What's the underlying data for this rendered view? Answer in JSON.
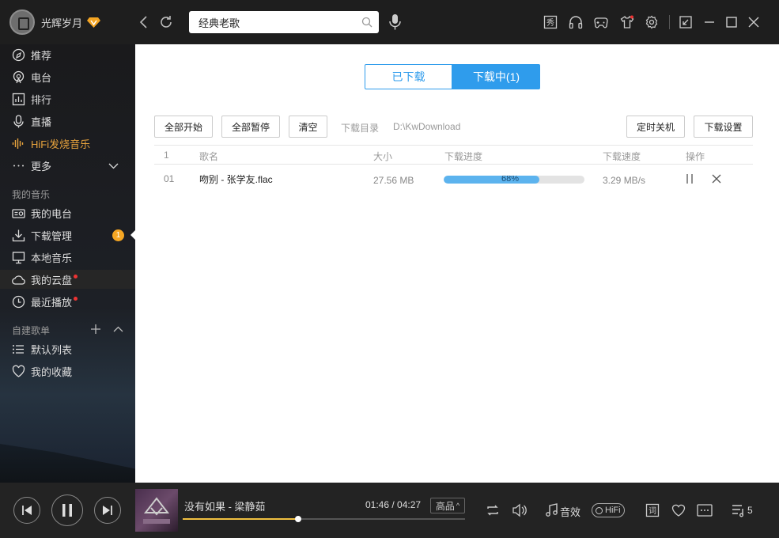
{
  "user": {
    "name": "光辉岁月"
  },
  "search": {
    "value": "经典老歌"
  },
  "sidebar": {
    "items": [
      {
        "label": "推荐"
      },
      {
        "label": "电台"
      },
      {
        "label": "排行"
      },
      {
        "label": "直播"
      },
      {
        "label": "HiFi发烧音乐"
      },
      {
        "label": "更多"
      }
    ],
    "my_music_title": "我的音乐",
    "my_music": [
      {
        "label": "我的电台"
      },
      {
        "label": "下载管理",
        "badge": "1"
      },
      {
        "label": "本地音乐"
      },
      {
        "label": "我的云盘"
      },
      {
        "label": "最近播放"
      }
    ],
    "playlists_title": "自建歌单",
    "playlists": [
      {
        "label": "默认列表"
      },
      {
        "label": "我的收藏"
      }
    ]
  },
  "tabs": {
    "downloaded": "已下载",
    "downloading": "下载中(1)"
  },
  "toolbar": {
    "start_all": "全部开始",
    "pause_all": "全部暂停",
    "clear": "清空",
    "dir_label": "下载目录",
    "dir_path": "D:\\KwDownload",
    "shutdown": "定时关机",
    "settings": "下载设置"
  },
  "table": {
    "headers": {
      "index": "1",
      "name": "歌名",
      "size": "大小",
      "progress": "下载进度",
      "speed": "下载速度",
      "ops": "操作"
    },
    "rows": [
      {
        "index": "01",
        "name": "吻别 - 张学友.flac",
        "size": "27.56 MB",
        "progress_text": "68%",
        "progress": 0.68,
        "speed": "3.29 MB/s"
      }
    ]
  },
  "player": {
    "song": "没有如果 - 梁静茹",
    "time": "01:46 / 04:27",
    "quality": "高品",
    "position": 0.41,
    "effect_label": "音效",
    "hifi_label": "HiFi",
    "queue_count": "5"
  },
  "colors": {
    "accent": "#2f9cec",
    "gold": "#e8a33d",
    "badge": "#f5a623"
  }
}
